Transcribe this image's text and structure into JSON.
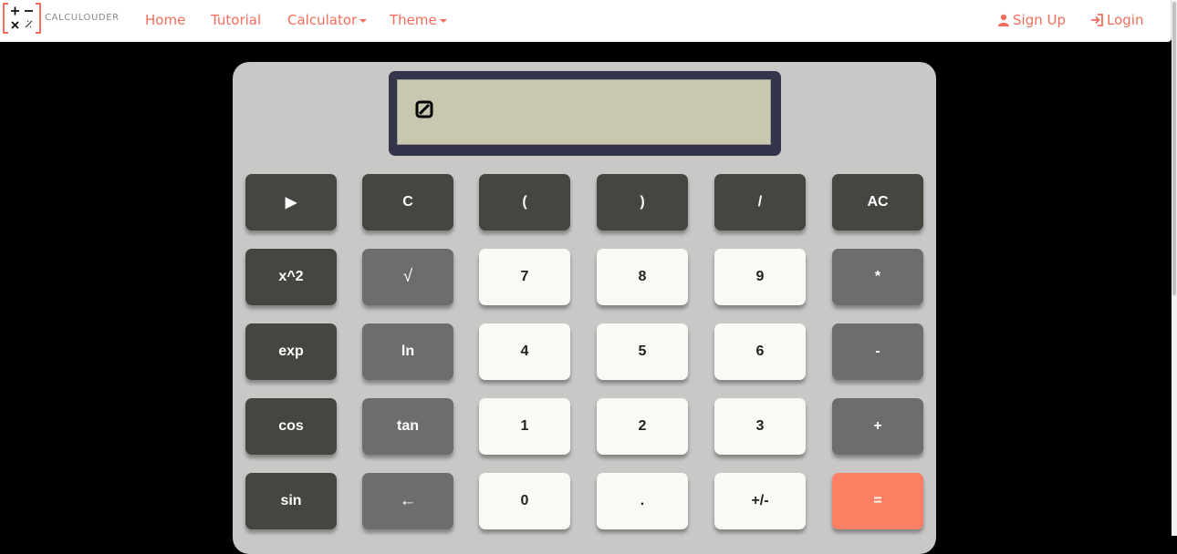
{
  "nav": {
    "logo_text": "CALCULOUDER",
    "home": "Home",
    "tutorial": "Tutorial",
    "calculator": "Calculator",
    "theme": "Theme",
    "signup": "Sign Up",
    "login": "Login"
  },
  "display": {
    "value": ""
  },
  "keys": {
    "row1": [
      "▶",
      "C",
      "(",
      ")",
      "/",
      "AC"
    ],
    "row2": [
      "x^2",
      "√",
      "7",
      "8",
      "9",
      "*"
    ],
    "row3": [
      "exp",
      "ln",
      "4",
      "5",
      "6",
      "-"
    ],
    "row4": [
      "cos",
      "tan",
      "1",
      "2",
      "3",
      "+"
    ],
    "row5": [
      "sin",
      "←",
      "0",
      ".",
      "+/-",
      "="
    ]
  },
  "colors": {
    "brand": "#f26d5b",
    "key_dark": "#464641",
    "key_mid": "#6d6d6b",
    "key_light": "#fbf9f3",
    "key_equals": "#fd8065",
    "display_bg": "#c8c8b1",
    "display_frame": "#34344a",
    "calculator_body": "#c9c8c7"
  }
}
